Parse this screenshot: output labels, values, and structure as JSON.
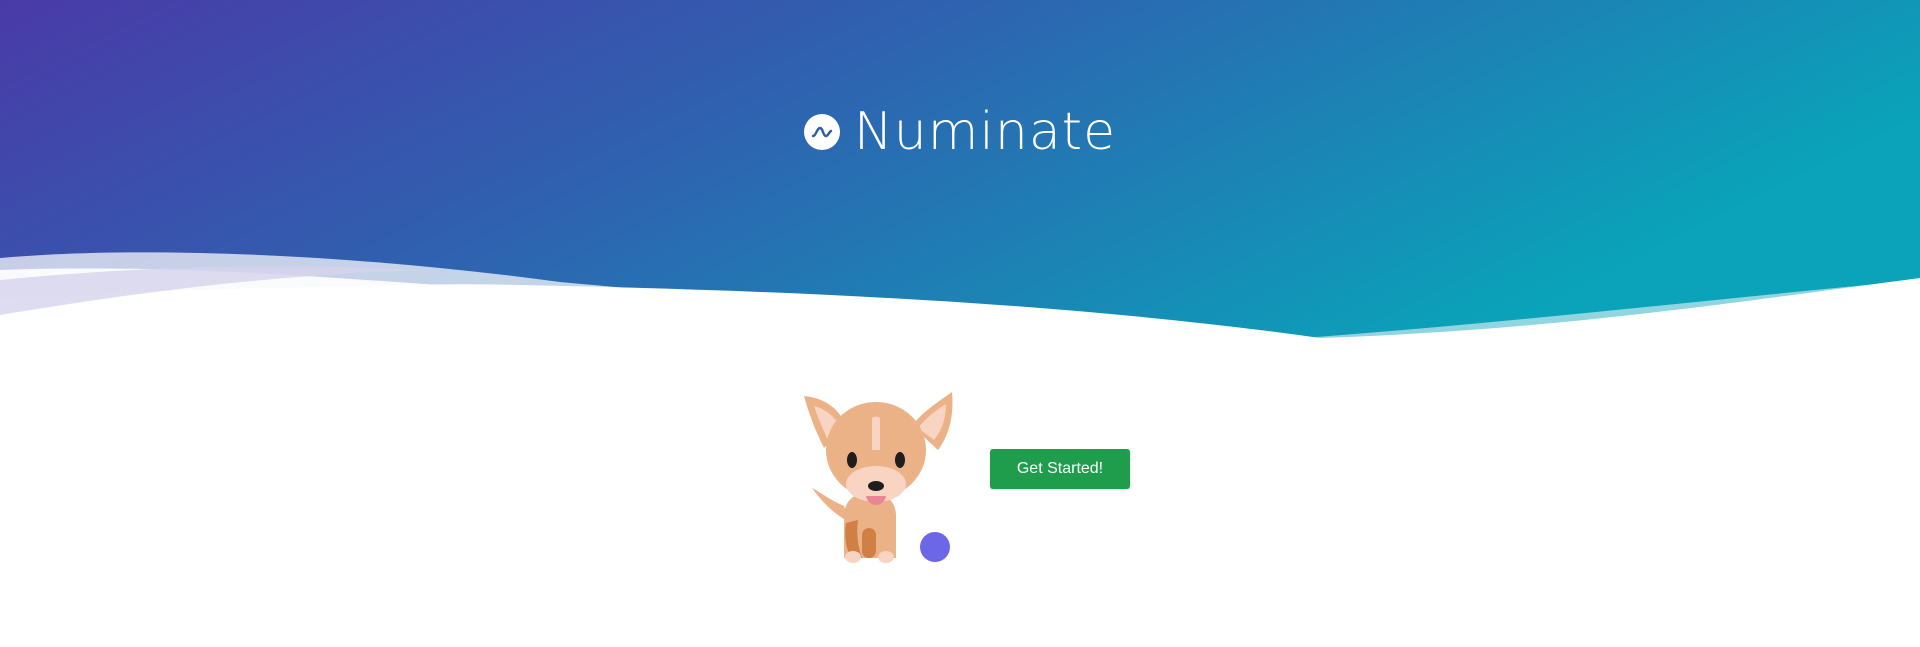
{
  "app": {
    "name": "Numinate",
    "logo_icon": "wave-logo-icon"
  },
  "hero": {
    "gradient_start": "#4a3aa8",
    "gradient_end": "#0aa3b9"
  },
  "main": {
    "mascot_icon": "dog-mascot-icon",
    "ball_color": "#6b67e6",
    "cta_label": "Get Started!",
    "cta_color": "#1f9d4c"
  }
}
